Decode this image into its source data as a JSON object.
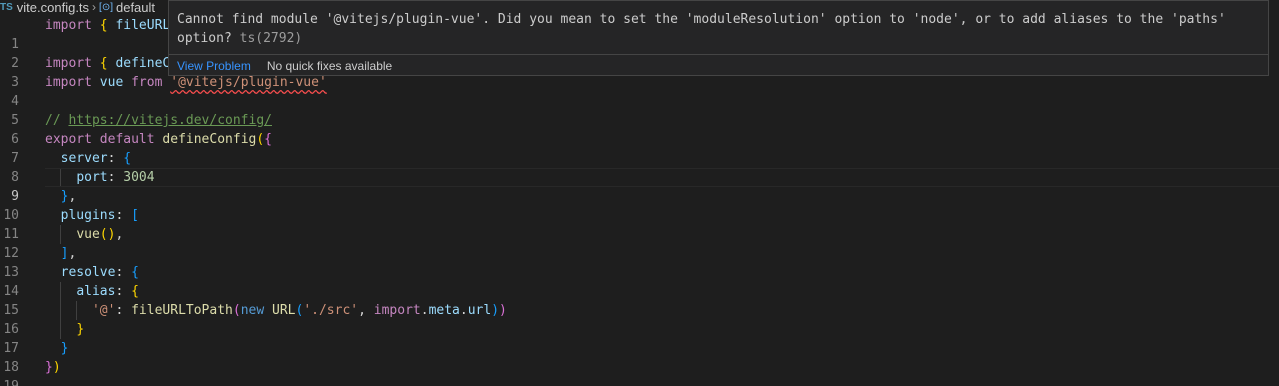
{
  "breadcrumb": {
    "file_icon": "TS",
    "file": "vite.config.ts",
    "symbol1": "default",
    "symbol2": "",
    "symbol3": ""
  },
  "lines": [
    {
      "n": "1"
    },
    {
      "n": "2"
    },
    {
      "n": "3"
    },
    {
      "n": "4"
    },
    {
      "n": "5"
    },
    {
      "n": "6"
    },
    {
      "n": "7"
    },
    {
      "n": "8"
    },
    {
      "n": "9"
    },
    {
      "n": "10"
    },
    {
      "n": "11"
    },
    {
      "n": "12"
    },
    {
      "n": "13"
    },
    {
      "n": "14"
    },
    {
      "n": "15"
    },
    {
      "n": "16"
    },
    {
      "n": "17"
    },
    {
      "n": "18"
    },
    {
      "n": "19"
    }
  ],
  "code": {
    "l1": [
      "import",
      "{",
      "fileURL"
    ],
    "l3": [
      "import",
      "{",
      "defineC"
    ],
    "l4": [
      "import",
      "vue",
      "from",
      "'@vitejs/plugin-vue'"
    ],
    "l6": [
      "//",
      "https://vitejs.dev/config/"
    ],
    "l7": [
      "export",
      "default",
      "defineConfig",
      "(",
      "{"
    ],
    "l8": [
      "server",
      ":",
      "{"
    ],
    "l9": [
      "port",
      ":",
      "3004"
    ],
    "l10": [
      "}",
      ","
    ],
    "l11": [
      "plugins",
      ":",
      "["
    ],
    "l12": [
      "vue",
      "()",
      ","
    ],
    "l13": [
      "]",
      ","
    ],
    "l14": [
      "resolve",
      ":",
      "{"
    ],
    "l15": [
      "alias",
      ":",
      "{"
    ],
    "l16": [
      "'@'",
      ":",
      "fileURLToPath",
      "(",
      "new",
      "URL",
      "(",
      "'./src'",
      ",",
      "import",
      ".",
      "meta",
      ".",
      "url",
      ")",
      ")"
    ],
    "l17": [
      "}"
    ],
    "l18": [
      "}"
    ],
    "l19": [
      "}",
      ")"
    ]
  },
  "hover": {
    "message": "Cannot find module '@vitejs/plugin-vue'. Did you mean to set the 'moduleResolution' option to 'node', or to add aliases to the 'paths' option?",
    "code": "ts(2792)",
    "view_problem": "View Problem",
    "no_fixes": "No quick fixes available"
  },
  "colors": {
    "background": "#1e1e1e",
    "error": "#f14c4c",
    "link": "#3794ff"
  }
}
